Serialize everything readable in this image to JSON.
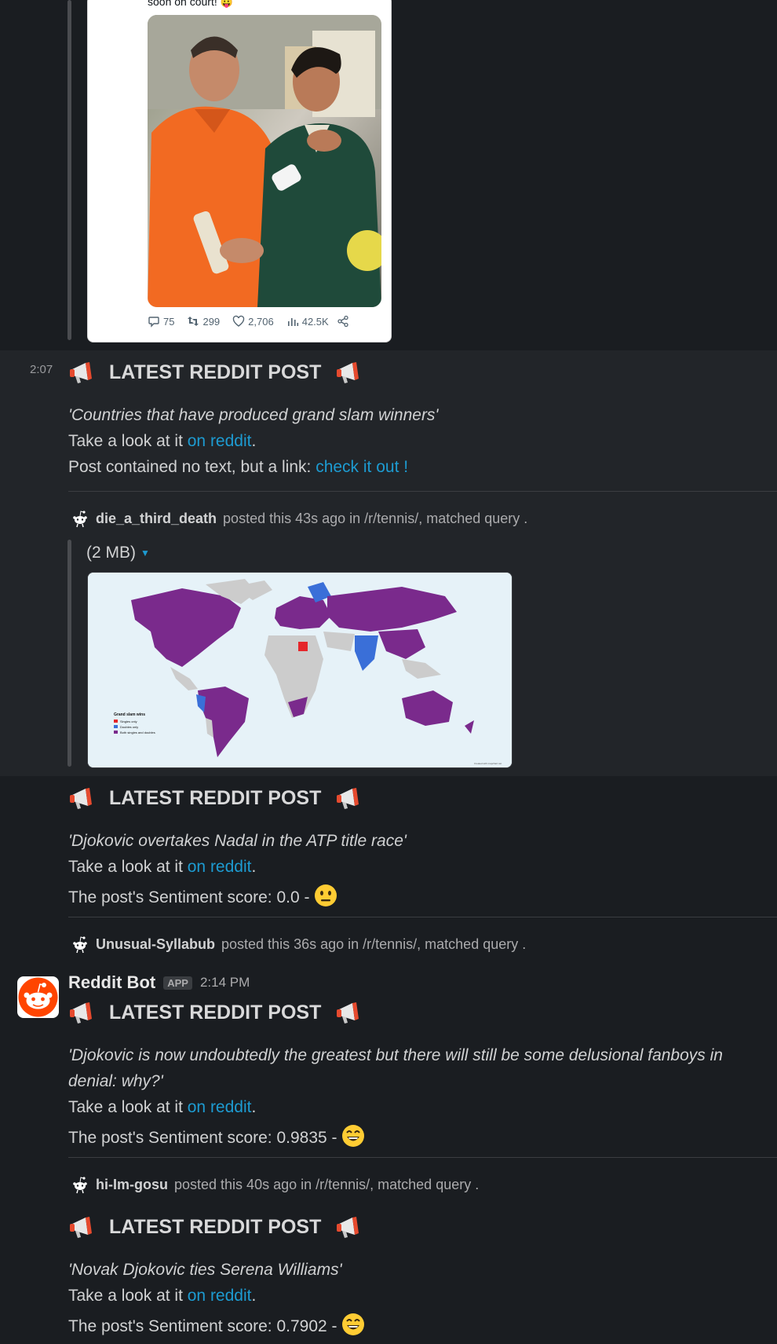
{
  "tweet": {
    "text": "soon on court!",
    "replies": "75",
    "retweets": "299",
    "likes": "2,706",
    "views": "42.5K"
  },
  "messages": [
    {
      "time": "2:07",
      "header": "LATEST REDDIT POST",
      "title": "'Countries that have produced grand slam winners'",
      "look_prefix": "Take a look at it ",
      "look_link": "on reddit",
      "look_suffix": ".",
      "extra_prefix": "Post contained no text, but a link: ",
      "extra_link": "check it out !",
      "author": "die_a_third_death",
      "meta_rest": "posted this 43s ago in /r/tennis/, matched query  .",
      "file_size": "(2 MB)",
      "map": {
        "legend_title": "Grand slam wins",
        "legend": [
          "Singles only",
          "Doubles only",
          "Both singles and doubles"
        ],
        "credit": "Created with mapchart.net",
        "colors": {
          "singles": "#e5262a",
          "doubles": "#3a6fd8",
          "both": "#7a2a8c",
          "none": "#cccccc",
          "sea": "#e6f2f8"
        }
      }
    },
    {
      "header": "LATEST REDDIT POST",
      "title": "'Djokovic overtakes Nadal in the ATP title race'",
      "look_prefix": "Take a look at it ",
      "look_link": "on reddit",
      "look_suffix": ".",
      "sentiment": "The post's Sentiment score: 0.0 - ",
      "emoji": "neutral-face",
      "author": "Unusual-Syllabub",
      "meta_rest": "posted this 36s ago in /r/tennis/, matched query  ."
    },
    {
      "bot_name": "Reddit Bot",
      "app_badge": "APP",
      "bot_time": "2:14 PM",
      "header": "LATEST REDDIT POST",
      "title_line1": "'Djokovic is now undoubtedly the greatest but there will still be some delusional fanboys in",
      "title_line2": "denial: why?'",
      "look_prefix": "Take a look at it ",
      "look_link": "on reddit",
      "look_suffix": ".",
      "sentiment": "The post's Sentiment score: 0.9835 - ",
      "emoji": "grinning-face",
      "author": "hi-Im-gosu",
      "meta_rest": "posted this 40s ago in /r/tennis/, matched query  ."
    },
    {
      "header": "LATEST REDDIT POST",
      "title": "'Novak Djokovic ties Serena Williams'",
      "look_prefix": "Take a look at it ",
      "look_link": "on reddit",
      "look_suffix": ".",
      "sentiment": "The post's Sentiment score: 0.7902 - ",
      "emoji": "grinning-face"
    }
  ]
}
